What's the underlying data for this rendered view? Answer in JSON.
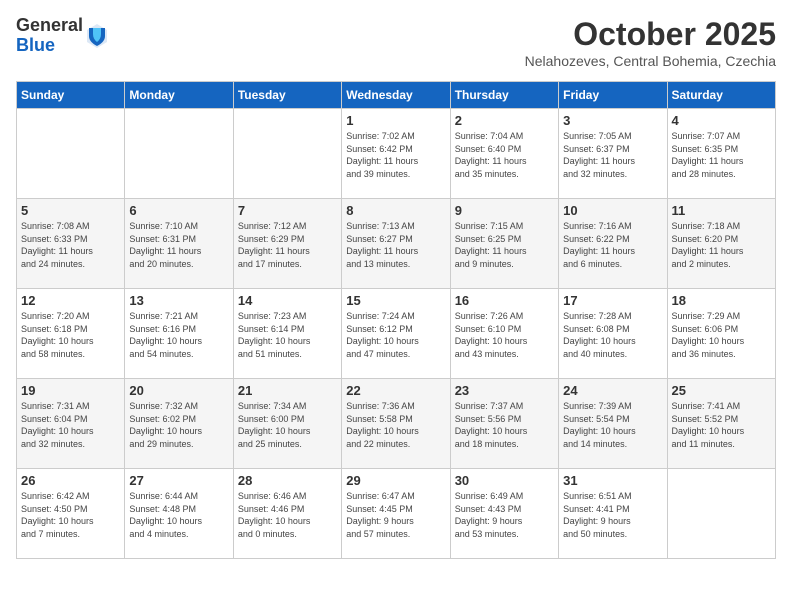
{
  "header": {
    "logo_general": "General",
    "logo_blue": "Blue",
    "month_title": "October 2025",
    "location": "Nelahozeves, Central Bohemia, Czechia"
  },
  "weekdays": [
    "Sunday",
    "Monday",
    "Tuesday",
    "Wednesday",
    "Thursday",
    "Friday",
    "Saturday"
  ],
  "weeks": [
    [
      {
        "day": "",
        "info": ""
      },
      {
        "day": "",
        "info": ""
      },
      {
        "day": "",
        "info": ""
      },
      {
        "day": "1",
        "info": "Sunrise: 7:02 AM\nSunset: 6:42 PM\nDaylight: 11 hours\nand 39 minutes."
      },
      {
        "day": "2",
        "info": "Sunrise: 7:04 AM\nSunset: 6:40 PM\nDaylight: 11 hours\nand 35 minutes."
      },
      {
        "day": "3",
        "info": "Sunrise: 7:05 AM\nSunset: 6:37 PM\nDaylight: 11 hours\nand 32 minutes."
      },
      {
        "day": "4",
        "info": "Sunrise: 7:07 AM\nSunset: 6:35 PM\nDaylight: 11 hours\nand 28 minutes."
      }
    ],
    [
      {
        "day": "5",
        "info": "Sunrise: 7:08 AM\nSunset: 6:33 PM\nDaylight: 11 hours\nand 24 minutes."
      },
      {
        "day": "6",
        "info": "Sunrise: 7:10 AM\nSunset: 6:31 PM\nDaylight: 11 hours\nand 20 minutes."
      },
      {
        "day": "7",
        "info": "Sunrise: 7:12 AM\nSunset: 6:29 PM\nDaylight: 11 hours\nand 17 minutes."
      },
      {
        "day": "8",
        "info": "Sunrise: 7:13 AM\nSunset: 6:27 PM\nDaylight: 11 hours\nand 13 minutes."
      },
      {
        "day": "9",
        "info": "Sunrise: 7:15 AM\nSunset: 6:25 PM\nDaylight: 11 hours\nand 9 minutes."
      },
      {
        "day": "10",
        "info": "Sunrise: 7:16 AM\nSunset: 6:22 PM\nDaylight: 11 hours\nand 6 minutes."
      },
      {
        "day": "11",
        "info": "Sunrise: 7:18 AM\nSunset: 6:20 PM\nDaylight: 11 hours\nand 2 minutes."
      }
    ],
    [
      {
        "day": "12",
        "info": "Sunrise: 7:20 AM\nSunset: 6:18 PM\nDaylight: 10 hours\nand 58 minutes."
      },
      {
        "day": "13",
        "info": "Sunrise: 7:21 AM\nSunset: 6:16 PM\nDaylight: 10 hours\nand 54 minutes."
      },
      {
        "day": "14",
        "info": "Sunrise: 7:23 AM\nSunset: 6:14 PM\nDaylight: 10 hours\nand 51 minutes."
      },
      {
        "day": "15",
        "info": "Sunrise: 7:24 AM\nSunset: 6:12 PM\nDaylight: 10 hours\nand 47 minutes."
      },
      {
        "day": "16",
        "info": "Sunrise: 7:26 AM\nSunset: 6:10 PM\nDaylight: 10 hours\nand 43 minutes."
      },
      {
        "day": "17",
        "info": "Sunrise: 7:28 AM\nSunset: 6:08 PM\nDaylight: 10 hours\nand 40 minutes."
      },
      {
        "day": "18",
        "info": "Sunrise: 7:29 AM\nSunset: 6:06 PM\nDaylight: 10 hours\nand 36 minutes."
      }
    ],
    [
      {
        "day": "19",
        "info": "Sunrise: 7:31 AM\nSunset: 6:04 PM\nDaylight: 10 hours\nand 32 minutes."
      },
      {
        "day": "20",
        "info": "Sunrise: 7:32 AM\nSunset: 6:02 PM\nDaylight: 10 hours\nand 29 minutes."
      },
      {
        "day": "21",
        "info": "Sunrise: 7:34 AM\nSunset: 6:00 PM\nDaylight: 10 hours\nand 25 minutes."
      },
      {
        "day": "22",
        "info": "Sunrise: 7:36 AM\nSunset: 5:58 PM\nDaylight: 10 hours\nand 22 minutes."
      },
      {
        "day": "23",
        "info": "Sunrise: 7:37 AM\nSunset: 5:56 PM\nDaylight: 10 hours\nand 18 minutes."
      },
      {
        "day": "24",
        "info": "Sunrise: 7:39 AM\nSunset: 5:54 PM\nDaylight: 10 hours\nand 14 minutes."
      },
      {
        "day": "25",
        "info": "Sunrise: 7:41 AM\nSunset: 5:52 PM\nDaylight: 10 hours\nand 11 minutes."
      }
    ],
    [
      {
        "day": "26",
        "info": "Sunrise: 6:42 AM\nSunset: 4:50 PM\nDaylight: 10 hours\nand 7 minutes."
      },
      {
        "day": "27",
        "info": "Sunrise: 6:44 AM\nSunset: 4:48 PM\nDaylight: 10 hours\nand 4 minutes."
      },
      {
        "day": "28",
        "info": "Sunrise: 6:46 AM\nSunset: 4:46 PM\nDaylight: 10 hours\nand 0 minutes."
      },
      {
        "day": "29",
        "info": "Sunrise: 6:47 AM\nSunset: 4:45 PM\nDaylight: 9 hours\nand 57 minutes."
      },
      {
        "day": "30",
        "info": "Sunrise: 6:49 AM\nSunset: 4:43 PM\nDaylight: 9 hours\nand 53 minutes."
      },
      {
        "day": "31",
        "info": "Sunrise: 6:51 AM\nSunset: 4:41 PM\nDaylight: 9 hours\nand 50 minutes."
      },
      {
        "day": "",
        "info": ""
      }
    ]
  ]
}
